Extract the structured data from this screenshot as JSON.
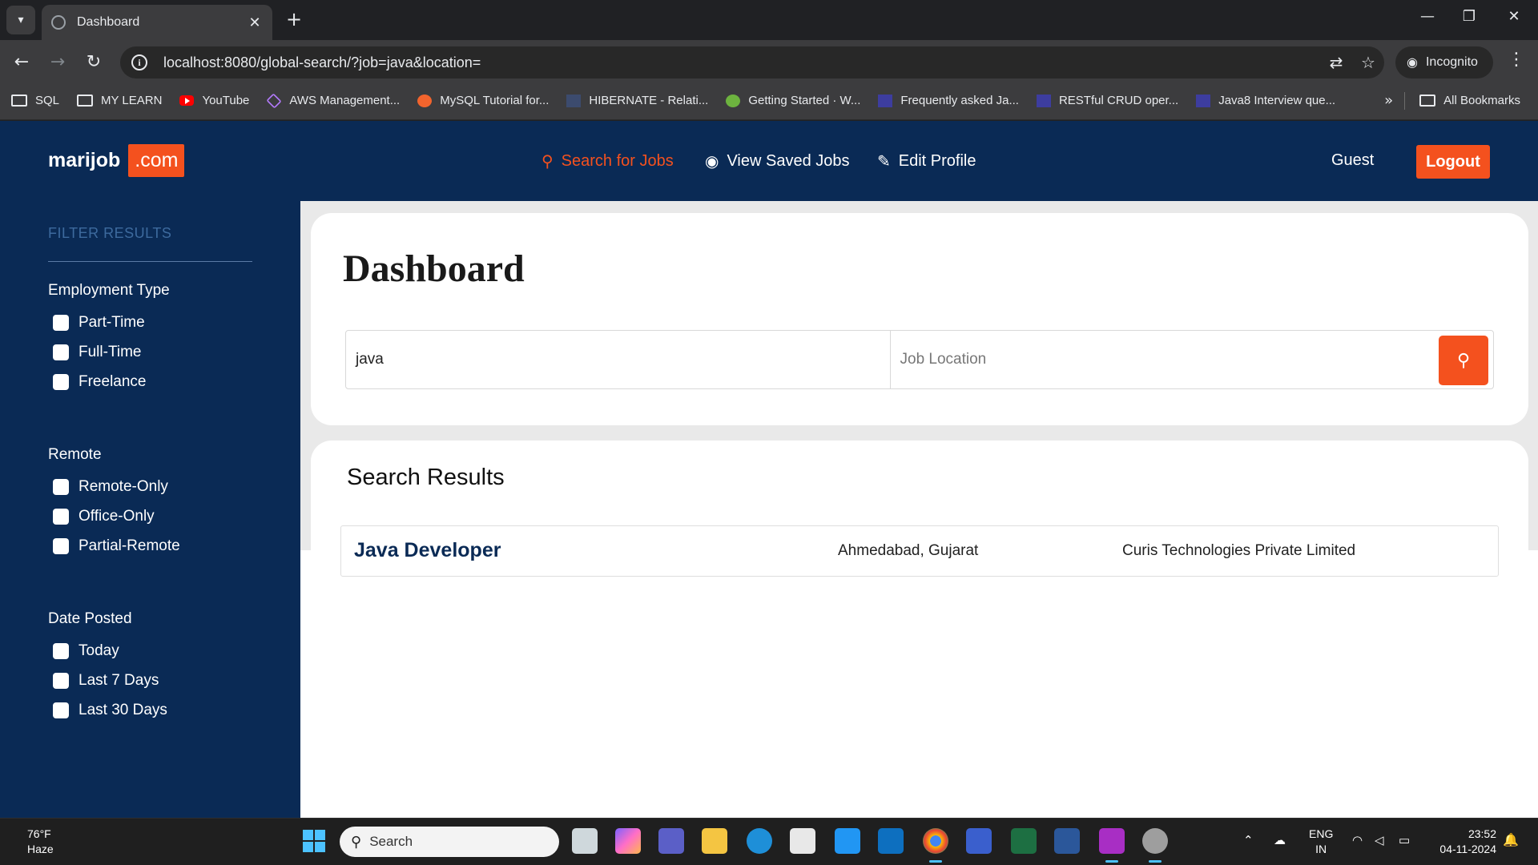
{
  "browser": {
    "tab_title": "Dashboard",
    "url": "localhost:8080/global-search/?job=java&location=",
    "incognito_label": "Incognito",
    "bookmarks": [
      {
        "label": "SQL",
        "icon": "folder-icon"
      },
      {
        "label": "MY LEARN",
        "icon": "folder-icon"
      },
      {
        "label": "YouTube",
        "icon": "youtube-icon"
      },
      {
        "label": "AWS Management...",
        "icon": "aws-icon"
      },
      {
        "label": "MySQL Tutorial for...",
        "icon": "mysql-icon"
      },
      {
        "label": "HIBERNATE - Relati...",
        "icon": "hibernate-icon"
      },
      {
        "label": "Getting Started · W...",
        "icon": "spring-icon"
      },
      {
        "label": "Frequently asked Ja...",
        "icon": "site-icon"
      },
      {
        "label": "RESTful CRUD oper...",
        "icon": "site-icon"
      },
      {
        "label": "Java8 Interview que...",
        "icon": "site-icon"
      }
    ],
    "all_bookmarks_label": "All Bookmarks"
  },
  "app": {
    "brand_name": "marijob",
    "brand_tld": ".com",
    "nav": {
      "search_jobs": "Search for Jobs",
      "saved_jobs": "View Saved Jobs",
      "edit_profile": "Edit Profile"
    },
    "user_label": "Guest",
    "logout_label": "Logout",
    "accent_color": "#f4511e",
    "primary_color": "#0a2a55"
  },
  "sidebar": {
    "title": "FILTER RESULTS",
    "groups": [
      {
        "title": "Employment Type",
        "options": [
          "Part-Time",
          "Full-Time",
          "Freelance"
        ]
      },
      {
        "title": "Remote",
        "options": [
          "Remote-Only",
          "Office-Only",
          "Partial-Remote"
        ]
      },
      {
        "title": "Date Posted",
        "options": [
          "Today",
          "Last 7 Days",
          "Last 30 Days"
        ]
      }
    ]
  },
  "dashboard": {
    "title": "Dashboard",
    "job_query_value": "java",
    "location_placeholder": "Job Location"
  },
  "results": {
    "title": "Search Results",
    "rows": [
      {
        "job": "Java Developer",
        "location": "Ahmedabad, Gujarat",
        "company": "Curis Technologies Private Limited"
      }
    ]
  },
  "taskbar": {
    "temperature": "76°F",
    "condition": "Haze",
    "search_label": "Search",
    "lang_line1": "ENG",
    "lang_line2": "IN",
    "time": "23:52",
    "date": "04-11-2024"
  }
}
